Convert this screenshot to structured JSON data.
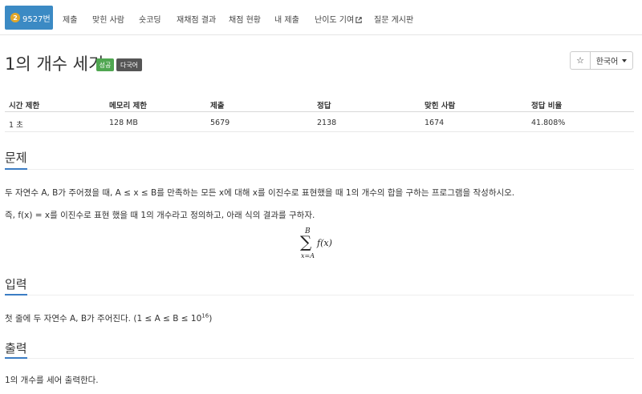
{
  "nav": {
    "active_tab": "9527번",
    "medal": "2",
    "items": [
      "제출",
      "맞힌 사람",
      "숏코딩",
      "재채점 결과",
      "채점 현황",
      "내 제출",
      "난이도 기여",
      "질문 게시판"
    ],
    "ext_icon": "external-link-icon"
  },
  "problem": {
    "title": "1의 개수 세기",
    "label_success": "성공",
    "label_multi": "다국어",
    "language": "한국어",
    "star_icon": "☆"
  },
  "info_table": {
    "headers": [
      "시간 제한",
      "메모리 제한",
      "제출",
      "정답",
      "맞힌 사람",
      "정답 비율"
    ],
    "row": [
      "1 초",
      "128 MB",
      "5679",
      "2138",
      "1674",
      "41.808%"
    ]
  },
  "sections": {
    "description": {
      "title": "문제",
      "line1": "두 자연수 A, B가 주어졌을 때, A ≤ x ≤ B를 만족하는 모든 x에 대해 x를 이진수로 표현했을 때 1의 개수의 합을 구하는 프로그램을 작성하시오.",
      "line2": "즉, f(x) = x를 이진수로 표현 했을 때 1의 개수라고 정의하고, 아래 식의 결과를 구하자.",
      "formula": {
        "upper": "B",
        "sigma": "∑",
        "lower": "x=A",
        "expr": "f(x)"
      }
    },
    "input": {
      "title": "입력",
      "text": "첫 줄에 두 자연수 A, B가 주어진다. (1 ≤ A ≤ B ≤ 10",
      "sup": "16",
      "close": ")"
    },
    "output": {
      "title": "출력",
      "text": "1의 개수를 세어 출력한다."
    }
  },
  "colors": {
    "primary": "#3b8ac4",
    "success": "#4fa650",
    "medal": "#e0a62a",
    "accent_line": "#3b7dc4"
  }
}
